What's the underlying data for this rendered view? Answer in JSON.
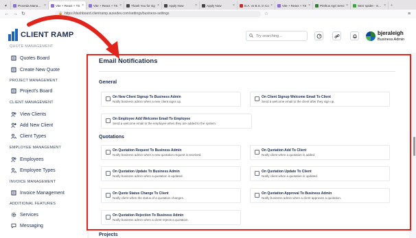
{
  "browser": {
    "tabs": [
      {
        "label": "Proveda Managem"
      },
      {
        "label": "Vite + React + TS"
      },
      {
        "label": "Vite + React + TS"
      },
      {
        "label": "Thank You for sig"
      },
      {
        "label": "Apply Now"
      },
      {
        "label": "Apply Now"
      },
      {
        "label": "B.A. vs B.S. in Co"
      },
      {
        "label": "Vite + React + TS"
      },
      {
        "label": "Pinthus Agri Servi"
      },
      {
        "label": "SEO spider - Scre"
      }
    ],
    "url": "https://dashboard.clientramp.auxedev.com/settings/business-settings"
  },
  "sidebar": {
    "logo_text": "CLIENT RAMP",
    "cut_heading": "QUOTE MANAGEMENT",
    "sections": [
      {
        "heading": "",
        "items": [
          {
            "label": "Quotes Board",
            "icon": "board-icon"
          },
          {
            "label": "Create New Quote",
            "icon": "board-icon"
          }
        ]
      },
      {
        "heading": "PROJECT MANAGEMENT",
        "items": [
          {
            "label": "Project's Board",
            "icon": "board-icon"
          }
        ]
      },
      {
        "heading": "CLIENT MANAGEMENT",
        "items": [
          {
            "label": "View Clients",
            "icon": "users-icon"
          },
          {
            "label": "Add New Client",
            "icon": "user-add-icon"
          },
          {
            "label": "Client Types",
            "icon": "user-types-icon"
          }
        ]
      },
      {
        "heading": "EMPLOYEE MANAGEMENT",
        "items": [
          {
            "label": "Employees",
            "icon": "users-icon"
          },
          {
            "label": "Employee Types",
            "icon": "user-types-icon"
          }
        ]
      },
      {
        "heading": "INVOICE MANAGEMENT",
        "items": [
          {
            "label": "Invoice Management",
            "icon": "board-icon"
          }
        ]
      },
      {
        "heading": "ADDITIONAL FEATURES",
        "items": [
          {
            "label": "Services",
            "icon": "gear-icon"
          },
          {
            "label": "Messaging",
            "icon": "chat-icon"
          }
        ]
      }
    ]
  },
  "header": {
    "search_placeholder": "Try searching...",
    "user_name": "bjeraleigh",
    "user_role": "Business Admin"
  },
  "email": {
    "title": "Email Notifications",
    "groups": [
      {
        "title": "General",
        "options": [
          {
            "title": "On New Client Signup To Business Admin",
            "desc": "Notify business admin when a new client signs up."
          },
          {
            "title": "On Client Signup Welcome Email To Client",
            "desc": "Send a welcome email to the client after they sign up."
          },
          {
            "title": "On Employee Add Welcome Email To Employee",
            "desc": "Send a welcome email to the employee when they are added to the system."
          }
        ]
      },
      {
        "title": "Quotations",
        "options": [
          {
            "title": "On Quotation Request To Business Admin",
            "desc": "Notify business admin when a new quotation request is received."
          },
          {
            "title": "On Quotation Add To Client",
            "desc": "Notify client when a quotation is added."
          },
          {
            "title": "On Quotation Update To Business Admin",
            "desc": "Notify business admin when a quotation is updated."
          },
          {
            "title": "On Quotation Update To Client",
            "desc": "Notify client when a quotation is updated."
          },
          {
            "title": "On Quote Status Change To Client",
            "desc": "Notify client when the status of a quotation changes."
          },
          {
            "title": "On Quotation Approval To Business Admin",
            "desc": "Notify business admin when a client approves a quotation."
          },
          {
            "title": "On Quotation Rejection To Business Admin",
            "desc": "Notify business admin when a client rejects a quotation."
          }
        ]
      }
    ],
    "next_section": "Projects"
  },
  "colors": {
    "accent": "#1f64b9",
    "highlight": "#e0241c"
  }
}
